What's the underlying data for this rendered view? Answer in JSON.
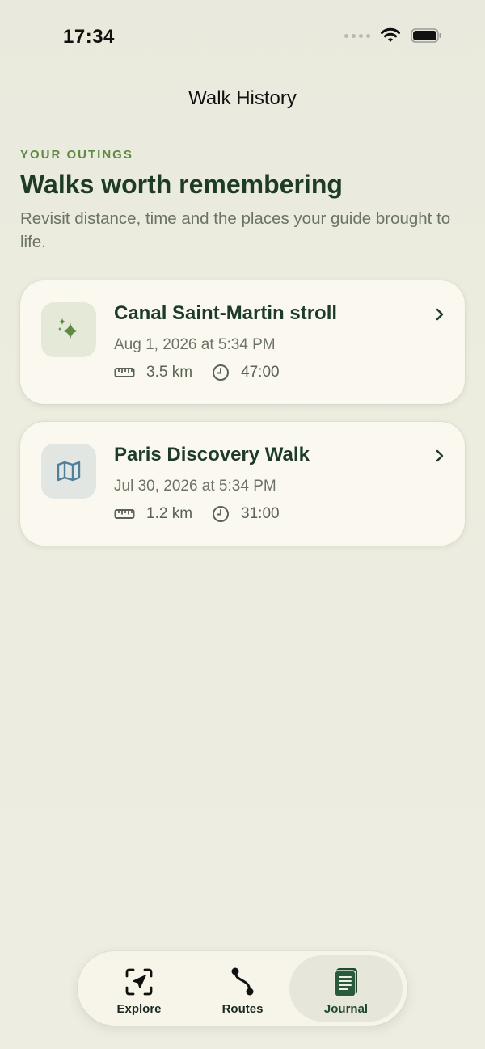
{
  "status_bar": {
    "time": "17:34",
    "icons": [
      "signal-dots-icon",
      "wifi-icon",
      "battery-icon"
    ]
  },
  "header": {
    "title": "Walk History"
  },
  "intro": {
    "eyebrow": "YOUR OUTINGS",
    "headline": "Walks worth remembering",
    "subtitle": "Revisit distance, time and the places your guide brought to life."
  },
  "walks": [
    {
      "icon": "sparkles-icon",
      "title": "Canal Saint-Martin stroll",
      "date": "Aug 1, 2026 at 5:34 PM",
      "distance": "3.5 km",
      "duration": "47:00"
    },
    {
      "icon": "map-icon",
      "title": "Paris Discovery Walk",
      "date": "Jul 30, 2026 at 5:34 PM",
      "distance": "1.2 km",
      "duration": "31:00"
    }
  ],
  "tabbar": {
    "tabs": [
      {
        "label": "Explore",
        "icon": "explore-icon",
        "selected": false
      },
      {
        "label": "Routes",
        "icon": "routes-icon",
        "selected": false
      },
      {
        "label": "Journal",
        "icon": "journal-icon",
        "selected": true
      }
    ]
  },
  "colors": {
    "accent_green": "#5f8a44",
    "headline": "#1d3b28",
    "card_bg": "#fbf9ef",
    "map_icon": "#4f7f9a"
  }
}
